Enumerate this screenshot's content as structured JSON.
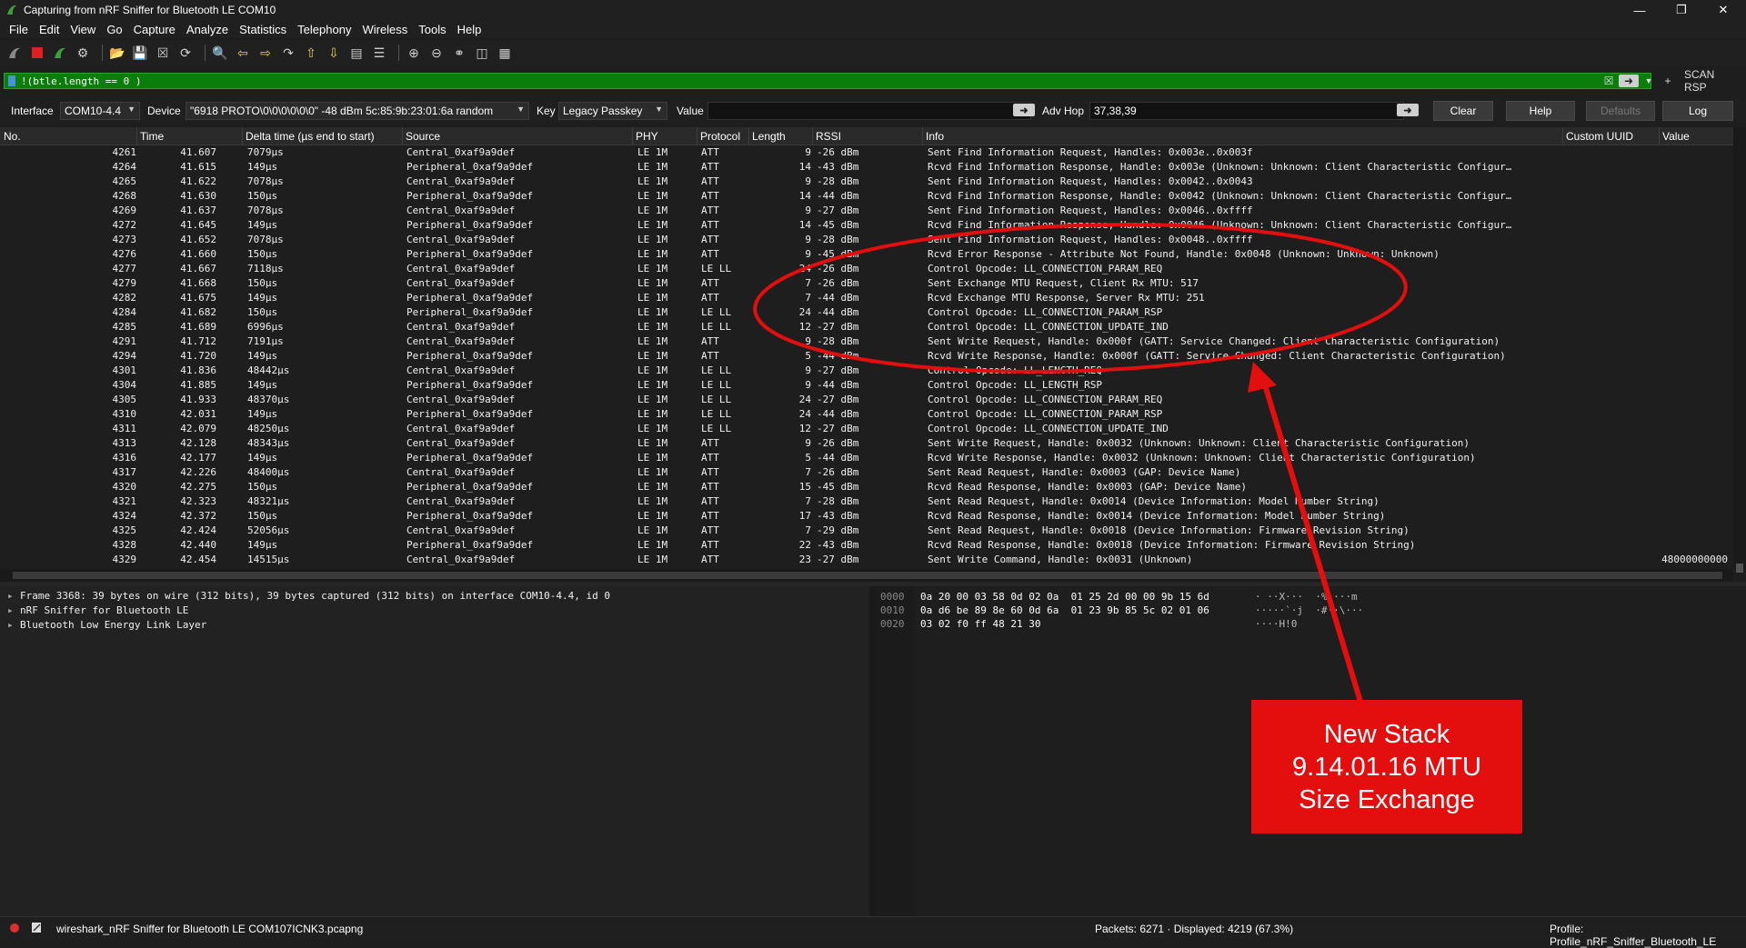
{
  "window": {
    "title": "Capturing from nRF Sniffer for Bluetooth LE COM10"
  },
  "menu": [
    "File",
    "Edit",
    "View",
    "Go",
    "Capture",
    "Analyze",
    "Statistics",
    "Telephony",
    "Wireless",
    "Tools",
    "Help"
  ],
  "filter": {
    "text": "!(btle.length == 0 )",
    "scan_label": "SCAN RSP"
  },
  "controls": {
    "interface_label": "Interface",
    "interface_value": "COM10-4.4",
    "device_label": "Device",
    "device_value": "\"6918 PROTO\\0\\0\\0\\0\\0\\0\"  -48 dBm  5c:85:9b:23:01:6a  random",
    "key_label": "Key",
    "key_value": "Legacy Passkey",
    "value_label": "Value",
    "adv_hop_label": "Adv Hop",
    "adv_hop_value": "37,38,39",
    "clear": "Clear",
    "help": "Help",
    "defaults": "Defaults",
    "log": "Log"
  },
  "columns": [
    "No.",
    "Time",
    "Delta time (µs end to start)",
    "Source",
    "PHY",
    "Protocol",
    "Length",
    "RSSI",
    "Info",
    "Custom UUID",
    "Value"
  ],
  "packets": [
    {
      "no": "4261",
      "time": "41.607",
      "delta": "7079µs",
      "src": "Central_0xaf9a9def",
      "phy": "LE 1M",
      "proto": "ATT",
      "len": "9",
      "rssi": "-26 dBm",
      "info": "Sent Find Information Request, Handles: 0x003e..0x003f",
      "value": ""
    },
    {
      "no": "4264",
      "time": "41.615",
      "delta": "149µs",
      "src": "Peripheral_0xaf9a9def",
      "phy": "LE 1M",
      "proto": "ATT",
      "len": "14",
      "rssi": "-43 dBm",
      "info": "Rcvd Find Information Response, Handle: 0x003e (Unknown: Unknown: Client Characteristic Configur…",
      "value": ""
    },
    {
      "no": "4265",
      "time": "41.622",
      "delta": "7078µs",
      "src": "Central_0xaf9a9def",
      "phy": "LE 1M",
      "proto": "ATT",
      "len": "9",
      "rssi": "-28 dBm",
      "info": "Sent Find Information Request, Handles: 0x0042..0x0043",
      "value": ""
    },
    {
      "no": "4268",
      "time": "41.630",
      "delta": "150µs",
      "src": "Peripheral_0xaf9a9def",
      "phy": "LE 1M",
      "proto": "ATT",
      "len": "14",
      "rssi": "-44 dBm",
      "info": "Rcvd Find Information Response, Handle: 0x0042 (Unknown: Unknown: Client Characteristic Configur…",
      "value": ""
    },
    {
      "no": "4269",
      "time": "41.637",
      "delta": "7078µs",
      "src": "Central_0xaf9a9def",
      "phy": "LE 1M",
      "proto": "ATT",
      "len": "9",
      "rssi": "-27 dBm",
      "info": "Sent Find Information Request, Handles: 0x0046..0xffff",
      "value": ""
    },
    {
      "no": "4272",
      "time": "41.645",
      "delta": "149µs",
      "src": "Peripheral_0xaf9a9def",
      "phy": "LE 1M",
      "proto": "ATT",
      "len": "14",
      "rssi": "-45 dBm",
      "info": "Rcvd Find Information Response, Handle: 0x0046 (Unknown: Unknown: Client Characteristic Configur…",
      "value": ""
    },
    {
      "no": "4273",
      "time": "41.652",
      "delta": "7078µs",
      "src": "Central_0xaf9a9def",
      "phy": "LE 1M",
      "proto": "ATT",
      "len": "9",
      "rssi": "-28 dBm",
      "info": "Sent Find Information Request, Handles: 0x0048..0xffff",
      "value": ""
    },
    {
      "no": "4276",
      "time": "41.660",
      "delta": "150µs",
      "src": "Peripheral_0xaf9a9def",
      "phy": "LE 1M",
      "proto": "ATT",
      "len": "9",
      "rssi": "-45 dBm",
      "info": "Rcvd Error Response - Attribute Not Found, Handle: 0x0048 (Unknown: Unknown: Unknown)",
      "value": ""
    },
    {
      "no": "4277",
      "time": "41.667",
      "delta": "7118µs",
      "src": "Central_0xaf9a9def",
      "phy": "LE 1M",
      "proto": "LE LL",
      "len": "24",
      "rssi": "-26 dBm",
      "info": "Control Opcode: LL_CONNECTION_PARAM_REQ",
      "value": ""
    },
    {
      "no": "4279",
      "time": "41.668",
      "delta": "150µs",
      "src": "Central_0xaf9a9def",
      "phy": "LE 1M",
      "proto": "ATT",
      "len": "7",
      "rssi": "-26 dBm",
      "info": "Sent Exchange MTU Request, Client Rx MTU: 517",
      "value": ""
    },
    {
      "no": "4282",
      "time": "41.675",
      "delta": "149µs",
      "src": "Peripheral_0xaf9a9def",
      "phy": "LE 1M",
      "proto": "ATT",
      "len": "7",
      "rssi": "-44 dBm",
      "info": "Rcvd Exchange MTU Response, Server Rx MTU: 251",
      "value": ""
    },
    {
      "no": "4284",
      "time": "41.682",
      "delta": "150µs",
      "src": "Peripheral_0xaf9a9def",
      "phy": "LE 1M",
      "proto": "LE LL",
      "len": "24",
      "rssi": "-44 dBm",
      "info": "Control Opcode: LL_CONNECTION_PARAM_RSP",
      "value": ""
    },
    {
      "no": "4285",
      "time": "41.689",
      "delta": "6996µs",
      "src": "Central_0xaf9a9def",
      "phy": "LE 1M",
      "proto": "LE LL",
      "len": "12",
      "rssi": "-27 dBm",
      "info": "Control Opcode: LL_CONNECTION_UPDATE_IND",
      "value": ""
    },
    {
      "no": "4291",
      "time": "41.712",
      "delta": "7191µs",
      "src": "Central_0xaf9a9def",
      "phy": "LE 1M",
      "proto": "ATT",
      "len": "9",
      "rssi": "-28 dBm",
      "info": "Sent Write Request, Handle: 0x000f (GATT: Service Changed: Client Characteristic Configuration)",
      "value": ""
    },
    {
      "no": "4294",
      "time": "41.720",
      "delta": "149µs",
      "src": "Peripheral_0xaf9a9def",
      "phy": "LE 1M",
      "proto": "ATT",
      "len": "5",
      "rssi": "-44 dBm",
      "info": "Rcvd Write Response, Handle: 0x000f (GATT: Service Changed: Client Characteristic Configuration)",
      "value": ""
    },
    {
      "no": "4301",
      "time": "41.836",
      "delta": "48442µs",
      "src": "Central_0xaf9a9def",
      "phy": "LE 1M",
      "proto": "LE LL",
      "len": "9",
      "rssi": "-27 dBm",
      "info": "Control Opcode: LL_LENGTH_REQ",
      "value": ""
    },
    {
      "no": "4304",
      "time": "41.885",
      "delta": "149µs",
      "src": "Peripheral_0xaf9a9def",
      "phy": "LE 1M",
      "proto": "LE LL",
      "len": "9",
      "rssi": "-44 dBm",
      "info": "Control Opcode: LL_LENGTH_RSP",
      "value": ""
    },
    {
      "no": "4305",
      "time": "41.933",
      "delta": "48370µs",
      "src": "Central_0xaf9a9def",
      "phy": "LE 1M",
      "proto": "LE LL",
      "len": "24",
      "rssi": "-27 dBm",
      "info": "Control Opcode: LL_CONNECTION_PARAM_REQ",
      "value": ""
    },
    {
      "no": "4310",
      "time": "42.031",
      "delta": "149µs",
      "src": "Peripheral_0xaf9a9def",
      "phy": "LE 1M",
      "proto": "LE LL",
      "len": "24",
      "rssi": "-44 dBm",
      "info": "Control Opcode: LL_CONNECTION_PARAM_RSP",
      "value": ""
    },
    {
      "no": "4311",
      "time": "42.079",
      "delta": "48250µs",
      "src": "Central_0xaf9a9def",
      "phy": "LE 1M",
      "proto": "LE LL",
      "len": "12",
      "rssi": "-27 dBm",
      "info": "Control Opcode: LL_CONNECTION_UPDATE_IND",
      "value": ""
    },
    {
      "no": "4313",
      "time": "42.128",
      "delta": "48343µs",
      "src": "Central_0xaf9a9def",
      "phy": "LE 1M",
      "proto": "ATT",
      "len": "9",
      "rssi": "-26 dBm",
      "info": "Sent Write Request, Handle: 0x0032 (Unknown: Unknown: Client Characteristic Configuration)",
      "value": ""
    },
    {
      "no": "4316",
      "time": "42.177",
      "delta": "149µs",
      "src": "Peripheral_0xaf9a9def",
      "phy": "LE 1M",
      "proto": "ATT",
      "len": "5",
      "rssi": "-44 dBm",
      "info": "Rcvd Write Response, Handle: 0x0032 (Unknown: Unknown: Client Characteristic Configuration)",
      "value": ""
    },
    {
      "no": "4317",
      "time": "42.226",
      "delta": "48400µs",
      "src": "Central_0xaf9a9def",
      "phy": "LE 1M",
      "proto": "ATT",
      "len": "7",
      "rssi": "-26 dBm",
      "info": "Sent Read Request, Handle: 0x0003 (GAP: Device Name)",
      "value": ""
    },
    {
      "no": "4320",
      "time": "42.275",
      "delta": "150µs",
      "src": "Peripheral_0xaf9a9def",
      "phy": "LE 1M",
      "proto": "ATT",
      "len": "15",
      "rssi": "-45 dBm",
      "info": "Rcvd Read Response, Handle: 0x0003 (GAP: Device Name)",
      "value": ""
    },
    {
      "no": "4321",
      "time": "42.323",
      "delta": "48321µs",
      "src": "Central_0xaf9a9def",
      "phy": "LE 1M",
      "proto": "ATT",
      "len": "7",
      "rssi": "-28 dBm",
      "info": "Sent Read Request, Handle: 0x0014 (Device Information: Model Number String)",
      "value": ""
    },
    {
      "no": "4324",
      "time": "42.372",
      "delta": "150µs",
      "src": "Peripheral_0xaf9a9def",
      "phy": "LE 1M",
      "proto": "ATT",
      "len": "17",
      "rssi": "-43 dBm",
      "info": "Rcvd Read Response, Handle: 0x0014 (Device Information: Model Number String)",
      "value": ""
    },
    {
      "no": "4325",
      "time": "42.424",
      "delta": "52056µs",
      "src": "Central_0xaf9a9def",
      "phy": "LE 1M",
      "proto": "ATT",
      "len": "7",
      "rssi": "-29 dBm",
      "info": "Sent Read Request, Handle: 0x0018 (Device Information: Firmware Revision String)",
      "value": ""
    },
    {
      "no": "4328",
      "time": "42.440",
      "delta": "149µs",
      "src": "Peripheral_0xaf9a9def",
      "phy": "LE 1M",
      "proto": "ATT",
      "len": "22",
      "rssi": "-43 dBm",
      "info": "Rcvd Read Response, Handle: 0x0018 (Device Information: Firmware Revision String)",
      "value": ""
    },
    {
      "no": "4329",
      "time": "42.454",
      "delta": "14515µs",
      "src": "Central_0xaf9a9def",
      "phy": "LE 1M",
      "proto": "ATT",
      "len": "23",
      "rssi": "-27 dBm",
      "info": "Sent Write Command, Handle: 0x0031 (Unknown)",
      "value": "48000000000"
    }
  ],
  "details": [
    "Frame 3368: 39 bytes on wire (312 bits), 39 bytes captured (312 bits) on interface COM10-4.4, id 0",
    "nRF Sniffer for Bluetooth LE",
    "Bluetooth Low Energy Link Layer"
  ],
  "bytes": [
    {
      "offset": "0000",
      "hex": "0a 20 00 03 58 0d 02 0a  01 25 2d 00 00 9b 15 6d",
      "ascii": "· ··X···  ·%-···m"
    },
    {
      "offset": "0010",
      "hex": "0a d6 be 89 8e 60 0d 6a  01 23 9b 85 5c 02 01 06",
      "ascii": "·····`·j  ·#··\\···"
    },
    {
      "offset": "0020",
      "hex": "03 02 f0 ff 48 21 30",
      "ascii": "····H!0"
    }
  ],
  "annotation": {
    "lines": [
      "New Stack",
      "9.14.01.16 MTU",
      "Size Exchange"
    ],
    "color": "#e30e0e"
  },
  "status": {
    "file": "wireshark_nRF Sniffer for Bluetooth LE COM107ICNK3.pcapng",
    "packets": "Packets: 6271 · Displayed: 4219 (67.3%)",
    "profile": "Profile: Profile_nRF_Sniffer_Bluetooth_LE"
  }
}
